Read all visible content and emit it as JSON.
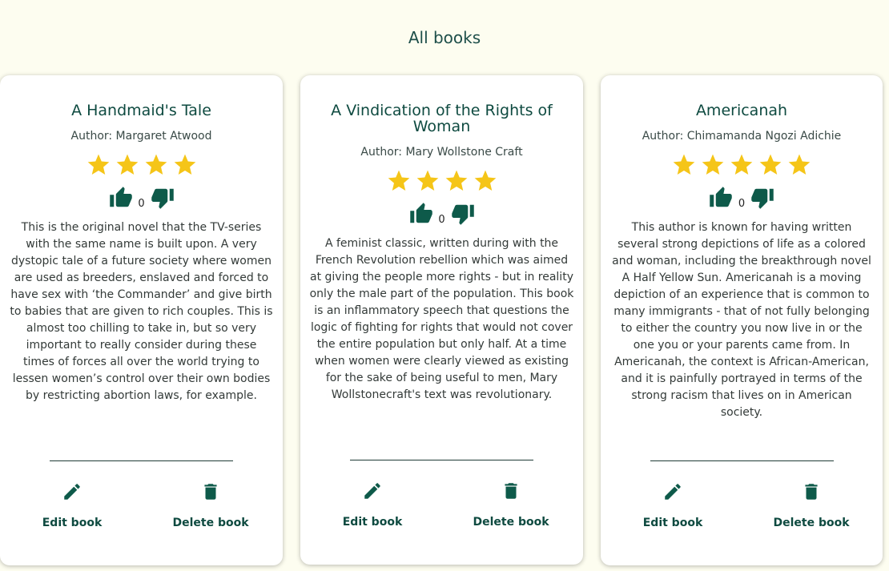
{
  "page": {
    "title": "All books"
  },
  "colors": {
    "star": "#f5c518",
    "accent": "#0e5a4a",
    "background": "#fdfdf0"
  },
  "icons": {
    "star": "star-icon",
    "up": "thumbs-up-icon",
    "down": "thumbs-down-icon",
    "edit": "pencil-icon",
    "delete": "trash-icon"
  },
  "books": [
    {
      "title": "A Handmaid's Tale",
      "author": "Author: Margaret Atwood",
      "rating": 4,
      "votes": "0",
      "description": "This is the original novel that the TV-series with the same name is built upon. A very dystopic tale of a future society where women are used as breeders, enslaved and forced to have sex with ‘the Commander’ and give birth to babies that are given to rich couples. This is almost too chilling to take in, but so very important to really consider during these times of forces all over the world trying to lessen women’s control over their own bodies by restricting abortion laws, for example.",
      "edit_label": "Edit book",
      "delete_label": "Delete book"
    },
    {
      "title": "A Vindication of the Rights of Woman",
      "author": "Author: Mary Wollstone Craft",
      "rating": 4,
      "votes": "0",
      "description": "A feminist classic, written during with the French Revolution rebellion which was aimed at giving the people more rights - but in reality only the male part of the population. This book is an inflammatory speech that questions the logic of fighting for rights that would not cover the entire population but only half. At a time when women were clearly viewed as existing for the sake of being useful to men, Mary Wollstonecraft's text was revolutionary.",
      "edit_label": "Edit book",
      "delete_label": "Delete book"
    },
    {
      "title": "Americanah",
      "author": "Author: Chimamanda Ngozi Adichie",
      "rating": 5,
      "votes": "0",
      "description": "This author is known for having written several strong depictions of life as a colored and woman, including the breakthrough novel A Half Yellow Sun. Americanah is a moving depiction of an experience that is common to many immigrants - that of not fully belonging to either the country you now live in or the one you or your parents came from. In Americanah, the context is African-American, and it is painfully portrayed in terms of the strong racism that lives on in American society.",
      "edit_label": "Edit book",
      "delete_label": "Delete book"
    }
  ]
}
